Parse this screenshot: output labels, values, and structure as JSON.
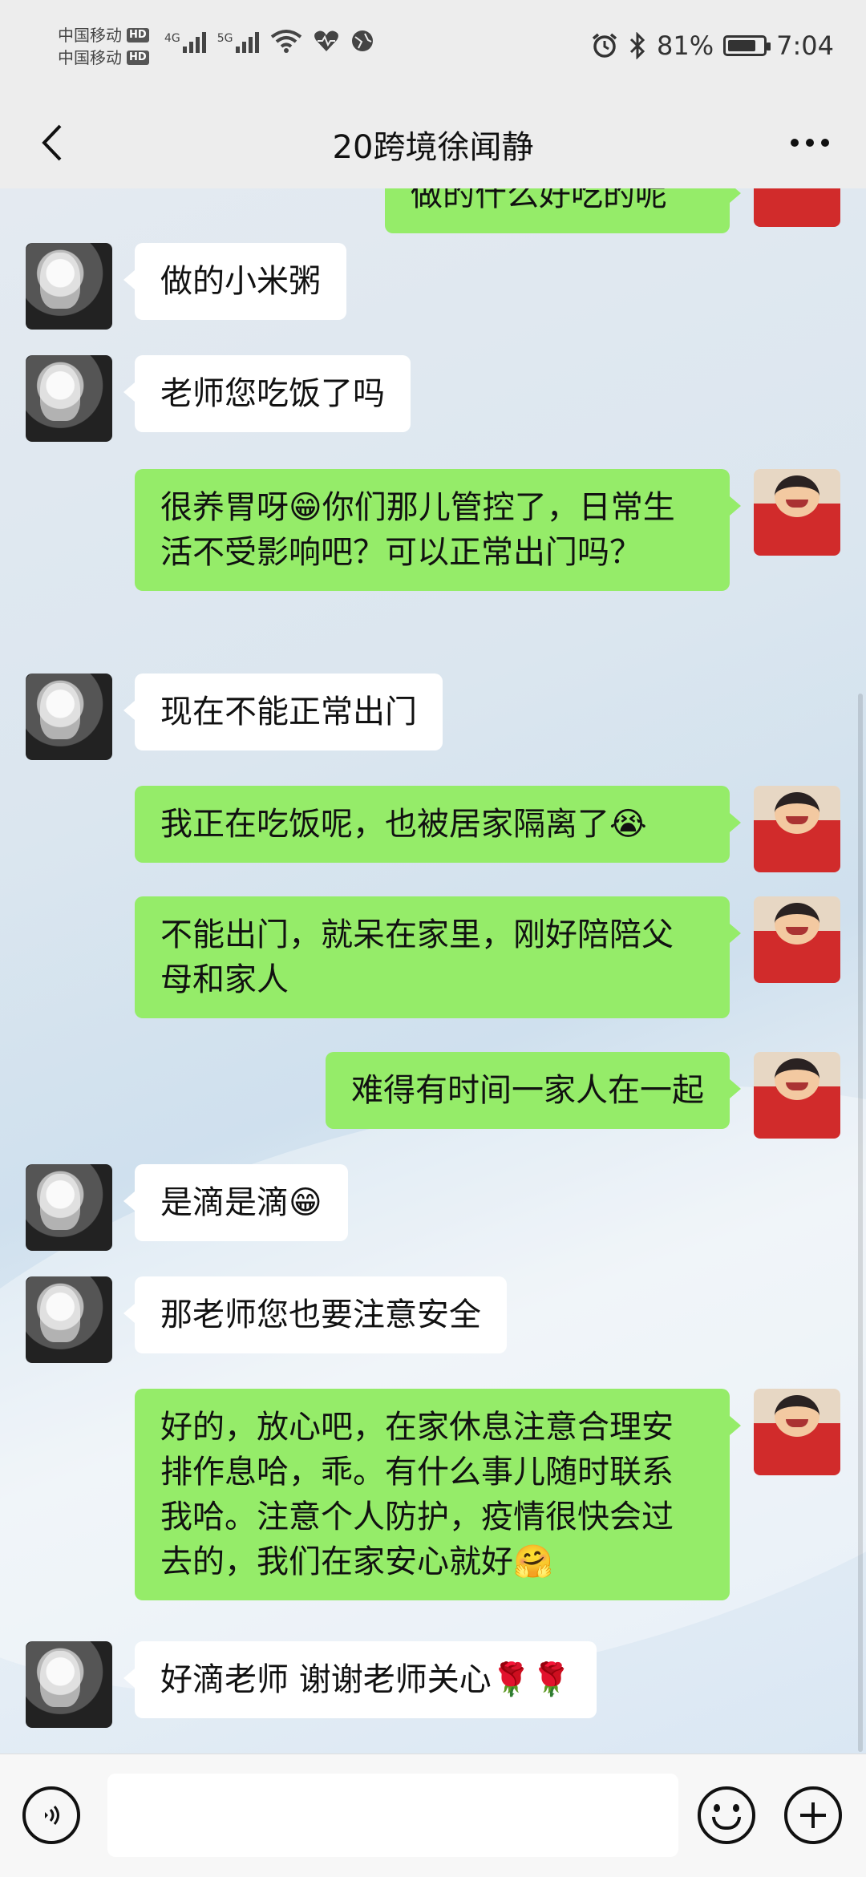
{
  "status_bar": {
    "carrier1": "中国移动",
    "carrier2": "中国移动",
    "hd": "HD",
    "net1": "4G",
    "net2": "5G",
    "battery_percent": "81%",
    "battery_level": 0.81,
    "time": "7:04",
    "icons": [
      "signal-bars-icon",
      "wifi-icon",
      "heart-rate-icon",
      "globe-icon",
      "alarm-icon",
      "bluetooth-icon",
      "battery-icon"
    ]
  },
  "header": {
    "title": "20跨境徐闻静",
    "more_label": "···"
  },
  "messages": [
    {
      "side": "out",
      "text": "做的什么好吃的呢"
    },
    {
      "side": "in",
      "text": "做的小米粥"
    },
    {
      "side": "in",
      "text": "老师您吃饭了吗"
    },
    {
      "side": "out",
      "text": "很养胃呀😁你们那儿管控了，日常生活不受影响吧？可以正常出门吗？"
    },
    {
      "side": "in",
      "text": "现在不能正常出门"
    },
    {
      "side": "out",
      "text": "我正在吃饭呢，也被居家隔离了😭"
    },
    {
      "side": "out",
      "text": "不能出门，就呆在家里，刚好陪陪父母和家人"
    },
    {
      "side": "out",
      "text": "难得有时间一家人在一起"
    },
    {
      "side": "in",
      "text": "是滴是滴😁"
    },
    {
      "side": "in",
      "text": "那老师您也要注意安全"
    },
    {
      "side": "out",
      "text": "好的，放心吧，在家休息注意合理安排作息哈，乖。有什么事儿随时联系我哈。注意个人防护，疫情很快会过去的，我们在家安心就好🤗"
    },
    {
      "side": "in",
      "text": "好滴老师 谢谢老师关心🌹🌹"
    }
  ],
  "input_bar": {
    "placeholder": "",
    "voice_icon": "voice-icon",
    "emoji_icon": "emoji-icon",
    "plus_icon": "plus-icon"
  }
}
